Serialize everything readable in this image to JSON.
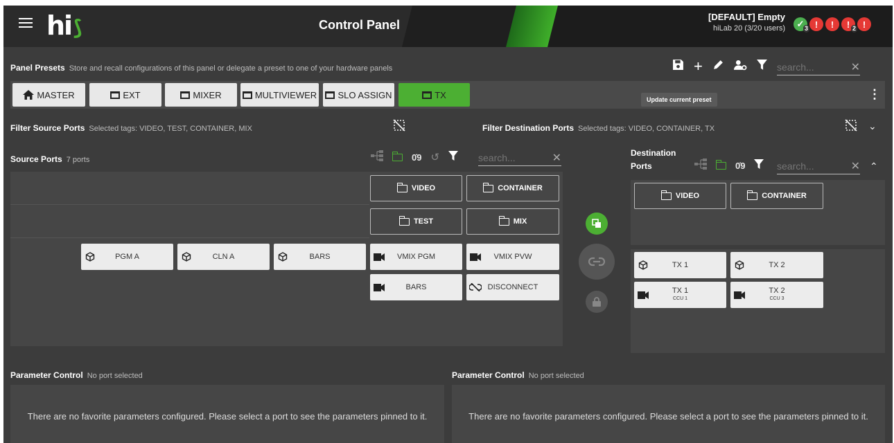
{
  "header": {
    "title": "Control Panel",
    "logo_text": "hi",
    "user_line1": "[DEFAULT] Empty",
    "user_line2": "hiLab 20 (3/20 users)",
    "status": [
      {
        "kind": "ok",
        "count": "3"
      },
      {
        "kind": "err",
        "count": ""
      },
      {
        "kind": "err",
        "count": ""
      },
      {
        "kind": "err",
        "count": "2"
      },
      {
        "kind": "err",
        "count": ""
      }
    ]
  },
  "presets": {
    "title": "Panel Presets",
    "subtitle": "Store and recall configurations of this panel or delegate a preset to one of your hardware panels",
    "search_placeholder": "search...",
    "tooltip": "Update current preset",
    "buttons": [
      {
        "label": "MASTER",
        "icon": "home-icon",
        "active": false
      },
      {
        "label": "EXT",
        "icon": "frame-icon",
        "active": false
      },
      {
        "label": "MIXER",
        "icon": "frame-icon",
        "active": false
      },
      {
        "label": "MULTIVIEWER",
        "icon": "frame-icon",
        "active": false
      },
      {
        "label": "SLO ASSIGN",
        "icon": "frame-icon",
        "active": false
      },
      {
        "label": "TX",
        "icon": "frame-icon",
        "active": true
      }
    ]
  },
  "filters": {
    "source_title": "Filter Source Ports",
    "source_tags": "Selected tags: VIDEO, TEST, CONTAINER, MIX",
    "dest_title": "Filter Destination Ports",
    "dest_tags": "Selected tags: VIDEO, CONTAINER, TX"
  },
  "source": {
    "title": "Source Ports",
    "count": "7 ports",
    "search_placeholder": "search...",
    "tags": [
      "VIDEO",
      "CONTAINER",
      "TEST",
      "MIX"
    ],
    "ports": [
      {
        "label": "PGM A",
        "icon": "cube-icon"
      },
      {
        "label": "CLN A",
        "icon": "cube-icon"
      },
      {
        "label": "BARS",
        "icon": "cube-icon"
      },
      {
        "label": "VMIX PGM",
        "icon": "camera-icon"
      },
      {
        "label": "VMIX PVW",
        "icon": "camera-icon"
      },
      {
        "label": "BARS",
        "icon": "camera-icon"
      },
      {
        "label": "DISCONNECT",
        "icon": "unlink-icon"
      }
    ]
  },
  "destination": {
    "title": "Destination Ports",
    "search_placeholder": "search...",
    "tags": [
      "VIDEO",
      "CONTAINER"
    ],
    "ports": [
      {
        "label": "TX 1",
        "sub": "",
        "icon": "cube-icon"
      },
      {
        "label": "TX 2",
        "sub": "",
        "icon": "cube-icon"
      },
      {
        "label": "TX 1",
        "sub": "CCU 1",
        "icon": "camera-icon"
      },
      {
        "label": "TX 2",
        "sub": "CCU 3",
        "icon": "camera-icon"
      }
    ]
  },
  "param": {
    "left_title": "Parameter Control",
    "left_sub": "No port selected",
    "left_msg": "There are no favorite parameters configured. Please select a port to see the parameters pinned to it.",
    "right_title": "Parameter Control",
    "right_sub": "No port selected",
    "right_msg": "There are no favorite parameters configured. Please select a port to see the parameters pinned to it."
  },
  "colors": {
    "accent": "#4caf33",
    "error": "#e53935",
    "background": "#3c3c3c"
  }
}
